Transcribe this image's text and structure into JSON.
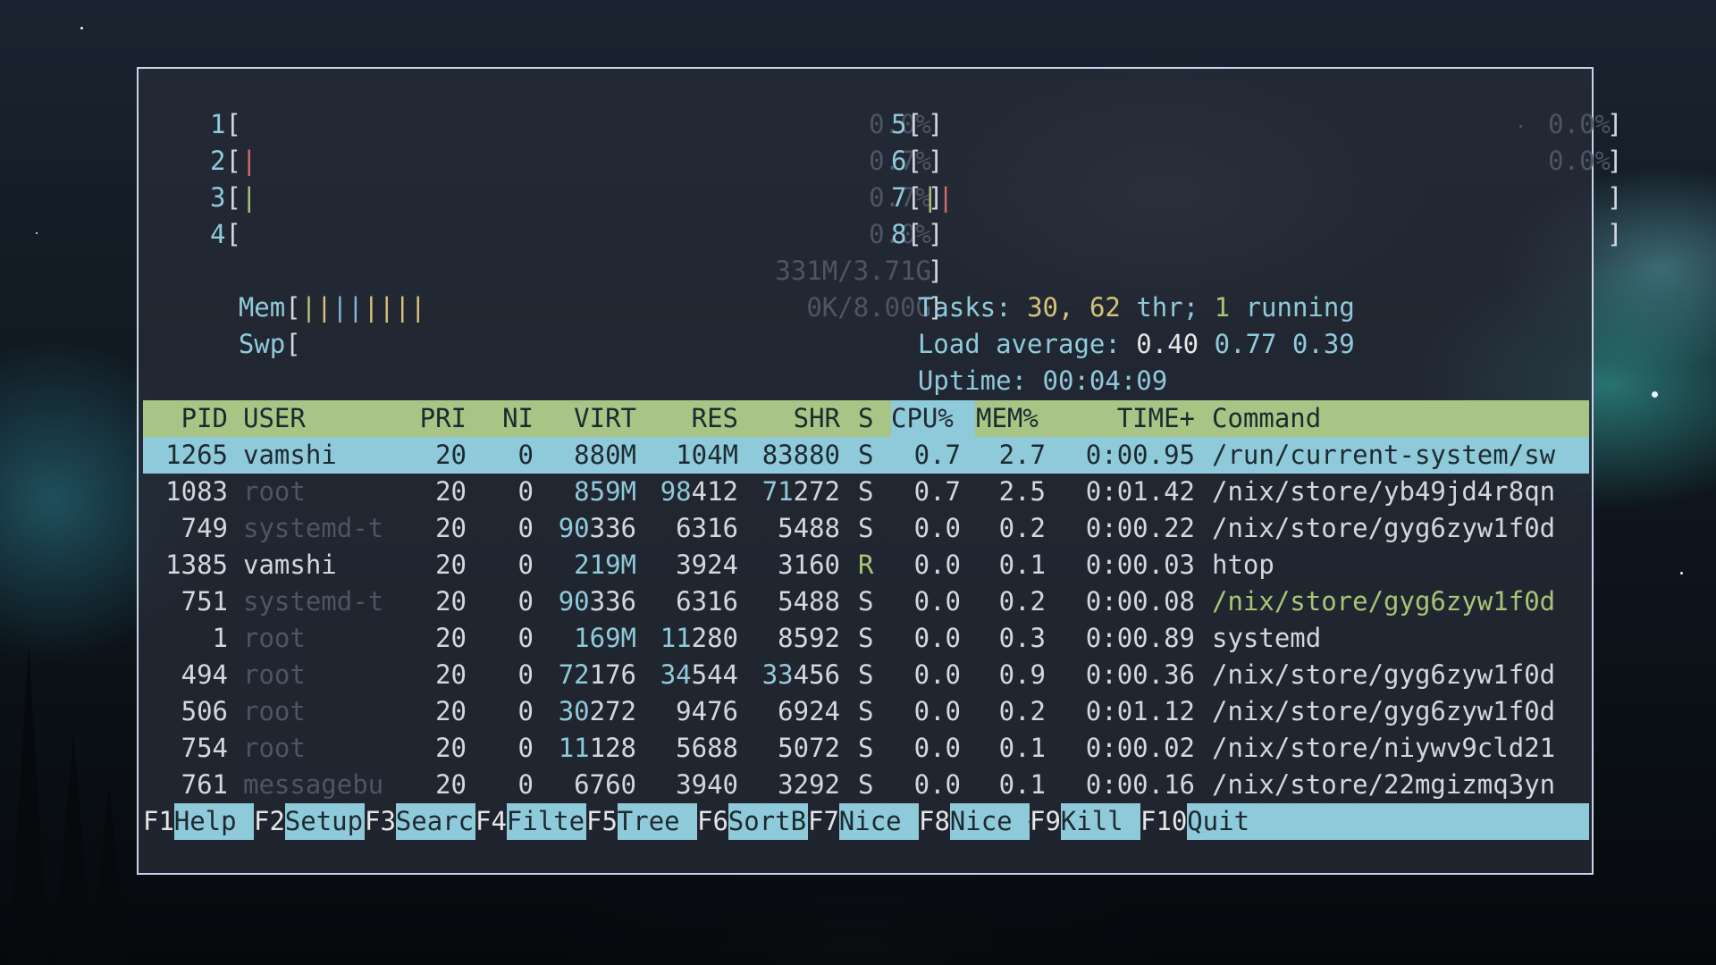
{
  "cpu_meters": [
    {
      "id": "1",
      "bars": [],
      "value": "0.0%"
    },
    {
      "id": "2",
      "bars": [
        "red"
      ],
      "value": "0.7%"
    },
    {
      "id": "3",
      "bars": [
        "green"
      ],
      "value": "0.7%"
    },
    {
      "id": "4",
      "bars": [],
      "value": "0.0%"
    },
    {
      "id": "5",
      "bars": [],
      "value": "0.0%"
    },
    {
      "id": "6",
      "bars": [],
      "value": "0.0%"
    },
    {
      "id": "7",
      "bars": [
        "green",
        "red"
      ],
      "value": ""
    },
    {
      "id": "8",
      "bars": [],
      "value": ""
    }
  ],
  "mem": {
    "label": "Mem",
    "bars": [
      "green",
      "yellow",
      "blue",
      "blue",
      "yellow",
      "yellow",
      "yellow",
      "yellow"
    ],
    "value": "331M/3.71G"
  },
  "swp": {
    "label": "Swp",
    "value": "0K/8.00G"
  },
  "tasks": {
    "label": "Tasks:",
    "count": "30,",
    "thr": "62",
    "thr_label": "thr;",
    "running": "1",
    "running_label": "running"
  },
  "load": {
    "label": "Load average:",
    "v1": "0.40",
    "v2": "0.77",
    "v3": "0.39"
  },
  "uptime": {
    "label": "Uptime:",
    "value": "00:04:09"
  },
  "columns": [
    "PID",
    "USER",
    "PRI",
    "NI",
    "VIRT",
    "RES",
    "SHR",
    "S",
    "CPU%",
    "MEM%",
    "TIME+",
    "Command"
  ],
  "processes": [
    {
      "pid": "1265",
      "user": "vamshi",
      "pri": "20",
      "ni": "0",
      "virt": "880M",
      "res": "104M",
      "shr": "83880",
      "s": "S",
      "cpu": "0.7",
      "mem": "2.7",
      "time": "0:00.95",
      "cmd": "/run/current-system/sw"
    },
    {
      "pid": "1083",
      "user": "root",
      "pri": "20",
      "ni": "0",
      "virt": "859M",
      "res": "98412",
      "shr": "71272",
      "s": "S",
      "cpu": "0.7",
      "mem": "2.5",
      "time": "0:01.42",
      "cmd": "/nix/store/yb49jd4r8qn"
    },
    {
      "pid": "749",
      "user": "systemd-t",
      "pri": "20",
      "ni": "0",
      "virt": "90336",
      "res": "6316",
      "shr": "5488",
      "s": "S",
      "cpu": "0.0",
      "mem": "0.2",
      "time": "0:00.22",
      "cmd": "/nix/store/gyg6zyw1f0d"
    },
    {
      "pid": "1385",
      "user": "vamshi",
      "pri": "20",
      "ni": "0",
      "virt": "219M",
      "res": "3924",
      "shr": "3160",
      "s": "R",
      "cpu": "0.0",
      "mem": "0.1",
      "time": "0:00.03",
      "cmd": "htop"
    },
    {
      "pid": "751",
      "user": "systemd-t",
      "pri": "20",
      "ni": "0",
      "virt": "90336",
      "res": "6316",
      "shr": "5488",
      "s": "S",
      "cpu": "0.0",
      "mem": "0.2",
      "time": "0:00.08",
      "cmd": "/nix/store/gyg6zyw1f0d"
    },
    {
      "pid": "1",
      "user": "root",
      "pri": "20",
      "ni": "0",
      "virt": "169M",
      "res": "11280",
      "shr": "8592",
      "s": "S",
      "cpu": "0.0",
      "mem": "0.3",
      "time": "0:00.89",
      "cmd": "systemd"
    },
    {
      "pid": "494",
      "user": "root",
      "pri": "20",
      "ni": "0",
      "virt": "72176",
      "res": "34544",
      "shr": "33456",
      "s": "S",
      "cpu": "0.0",
      "mem": "0.9",
      "time": "0:00.36",
      "cmd": "/nix/store/gyg6zyw1f0d"
    },
    {
      "pid": "506",
      "user": "root",
      "pri": "20",
      "ni": "0",
      "virt": "30272",
      "res": "9476",
      "shr": "6924",
      "s": "S",
      "cpu": "0.0",
      "mem": "0.2",
      "time": "0:01.12",
      "cmd": "/nix/store/gyg6zyw1f0d"
    },
    {
      "pid": "754",
      "user": "root",
      "pri": "20",
      "ni": "0",
      "virt": "11128",
      "res": "5688",
      "shr": "5072",
      "s": "S",
      "cpu": "0.0",
      "mem": "0.1",
      "time": "0:00.02",
      "cmd": "/nix/store/niywv9cld21"
    },
    {
      "pid": "761",
      "user": "messagebu",
      "pri": "20",
      "ni": "0",
      "virt": "6760",
      "res": "3940",
      "shr": "3292",
      "s": "S",
      "cpu": "0.0",
      "mem": "0.1",
      "time": "0:00.16",
      "cmd": "/nix/store/22mgizmq3yn"
    }
  ],
  "fkeys": [
    {
      "key": "F1",
      "label": "Help  "
    },
    {
      "key": "F2",
      "label": "Setup "
    },
    {
      "key": "F3",
      "label": "Search"
    },
    {
      "key": "F4",
      "label": "Filter"
    },
    {
      "key": "F5",
      "label": "Tree  "
    },
    {
      "key": "F6",
      "label": "SortBy"
    },
    {
      "key": "F7",
      "label": "Nice -"
    },
    {
      "key": "F8",
      "label": "Nice +"
    },
    {
      "key": "F9",
      "label": "Kill  "
    },
    {
      "key": "F10",
      "label": "Quit  "
    }
  ],
  "colors": {
    "cyan": "#8fcadb",
    "green": "#a8c576",
    "red": "#d46b6b",
    "yellow": "#d6c27a",
    "blue": "#7fb7d9",
    "header_bg": "#a8c585",
    "selection_bg": "#8fcadb"
  }
}
